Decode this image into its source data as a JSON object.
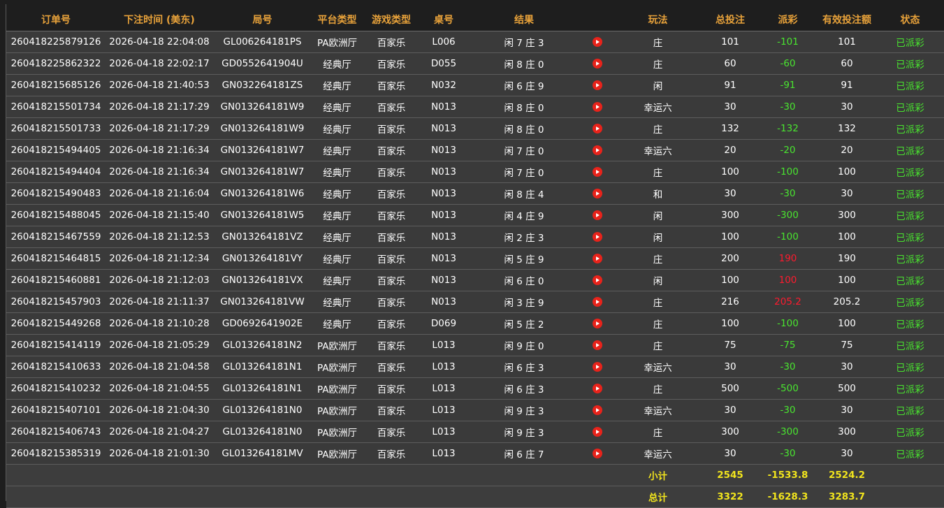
{
  "table": {
    "headers": {
      "order_id": "订单号",
      "bet_time": "下注时间 (美东)",
      "round_id": "局号",
      "platform": "平台类型",
      "game_type": "游戏类型",
      "table_no": "桌号",
      "result": "结果",
      "video": "",
      "play_type": "玩法",
      "total_bet": "总投注",
      "payout": "派彩",
      "valid_bet": "有效投注额",
      "status": "状态"
    },
    "rows": [
      {
        "order_id": "260418225879126",
        "bet_time": "2026-04-18 22:04:08",
        "round_id": "GL006264181PS",
        "platform": "PA欧洲厅",
        "game_type": "百家乐",
        "table_no": "L006",
        "result": "闲 7 庄 3",
        "play_type": "庄",
        "total_bet": "101",
        "payout": "-101",
        "valid_bet": "101",
        "status": "已派彩"
      },
      {
        "order_id": "260418225862322",
        "bet_time": "2026-04-18 22:02:17",
        "round_id": "GD0552641904U",
        "platform": "经典厅",
        "game_type": "百家乐",
        "table_no": "D055",
        "result": "闲 8 庄 0",
        "play_type": "庄",
        "total_bet": "60",
        "payout": "-60",
        "valid_bet": "60",
        "status": "已派彩"
      },
      {
        "order_id": "260418215685126",
        "bet_time": "2026-04-18 21:40:53",
        "round_id": "GN032264181ZS",
        "platform": "经典厅",
        "game_type": "百家乐",
        "table_no": "N032",
        "result": "闲 6 庄 9",
        "play_type": "闲",
        "total_bet": "91",
        "payout": "-91",
        "valid_bet": "91",
        "status": "已派彩"
      },
      {
        "order_id": "260418215501734",
        "bet_time": "2026-04-18 21:17:29",
        "round_id": "GN013264181W9",
        "platform": "经典厅",
        "game_type": "百家乐",
        "table_no": "N013",
        "result": "闲 8 庄 0",
        "play_type": "幸运六",
        "total_bet": "30",
        "payout": "-30",
        "valid_bet": "30",
        "status": "已派彩"
      },
      {
        "order_id": "260418215501733",
        "bet_time": "2026-04-18 21:17:29",
        "round_id": "GN013264181W9",
        "platform": "经典厅",
        "game_type": "百家乐",
        "table_no": "N013",
        "result": "闲 8 庄 0",
        "play_type": "庄",
        "total_bet": "132",
        "payout": "-132",
        "valid_bet": "132",
        "status": "已派彩"
      },
      {
        "order_id": "260418215494405",
        "bet_time": "2026-04-18 21:16:34",
        "round_id": "GN013264181W7",
        "platform": "经典厅",
        "game_type": "百家乐",
        "table_no": "N013",
        "result": "闲 7 庄 0",
        "play_type": "幸运六",
        "total_bet": "20",
        "payout": "-20",
        "valid_bet": "20",
        "status": "已派彩"
      },
      {
        "order_id": "260418215494404",
        "bet_time": "2026-04-18 21:16:34",
        "round_id": "GN013264181W7",
        "platform": "经典厅",
        "game_type": "百家乐",
        "table_no": "N013",
        "result": "闲 7 庄 0",
        "play_type": "庄",
        "total_bet": "100",
        "payout": "-100",
        "valid_bet": "100",
        "status": "已派彩"
      },
      {
        "order_id": "260418215490483",
        "bet_time": "2026-04-18 21:16:04",
        "round_id": "GN013264181W6",
        "platform": "经典厅",
        "game_type": "百家乐",
        "table_no": "N013",
        "result": "闲 8 庄 4",
        "play_type": "和",
        "total_bet": "30",
        "payout": "-30",
        "valid_bet": "30",
        "status": "已派彩"
      },
      {
        "order_id": "260418215488045",
        "bet_time": "2026-04-18 21:15:40",
        "round_id": "GN013264181W5",
        "platform": "经典厅",
        "game_type": "百家乐",
        "table_no": "N013",
        "result": "闲 4 庄 9",
        "play_type": "闲",
        "total_bet": "300",
        "payout": "-300",
        "valid_bet": "300",
        "status": "已派彩"
      },
      {
        "order_id": "260418215467559",
        "bet_time": "2026-04-18 21:12:53",
        "round_id": "GN013264181VZ",
        "platform": "经典厅",
        "game_type": "百家乐",
        "table_no": "N013",
        "result": "闲 2 庄 3",
        "play_type": "闲",
        "total_bet": "100",
        "payout": "-100",
        "valid_bet": "100",
        "status": "已派彩"
      },
      {
        "order_id": "260418215464815",
        "bet_time": "2026-04-18 21:12:34",
        "round_id": "GN013264181VY",
        "platform": "经典厅",
        "game_type": "百家乐",
        "table_no": "N013",
        "result": "闲 5 庄 9",
        "play_type": "庄",
        "total_bet": "200",
        "payout": "190",
        "valid_bet": "190",
        "status": "已派彩"
      },
      {
        "order_id": "260418215460881",
        "bet_time": "2026-04-18 21:12:03",
        "round_id": "GN013264181VX",
        "platform": "经典厅",
        "game_type": "百家乐",
        "table_no": "N013",
        "result": "闲 6 庄 0",
        "play_type": "闲",
        "total_bet": "100",
        "payout": "100",
        "valid_bet": "100",
        "status": "已派彩"
      },
      {
        "order_id": "260418215457903",
        "bet_time": "2026-04-18 21:11:37",
        "round_id": "GN013264181VW",
        "platform": "经典厅",
        "game_type": "百家乐",
        "table_no": "N013",
        "result": "闲 3 庄 9",
        "play_type": "庄",
        "total_bet": "216",
        "payout": "205.2",
        "valid_bet": "205.2",
        "status": "已派彩"
      },
      {
        "order_id": "260418215449268",
        "bet_time": "2026-04-18 21:10:28",
        "round_id": "GD0692641902E",
        "platform": "经典厅",
        "game_type": "百家乐",
        "table_no": "D069",
        "result": "闲 5 庄 2",
        "play_type": "庄",
        "total_bet": "100",
        "payout": "-100",
        "valid_bet": "100",
        "status": "已派彩"
      },
      {
        "order_id": "260418215414119",
        "bet_time": "2026-04-18 21:05:29",
        "round_id": "GL013264181N2",
        "platform": "PA欧洲厅",
        "game_type": "百家乐",
        "table_no": "L013",
        "result": "闲 9 庄 0",
        "play_type": "庄",
        "total_bet": "75",
        "payout": "-75",
        "valid_bet": "75",
        "status": "已派彩"
      },
      {
        "order_id": "260418215410633",
        "bet_time": "2026-04-18 21:04:58",
        "round_id": "GL013264181N1",
        "platform": "PA欧洲厅",
        "game_type": "百家乐",
        "table_no": "L013",
        "result": "闲 6 庄 3",
        "play_type": "幸运六",
        "total_bet": "30",
        "payout": "-30",
        "valid_bet": "30",
        "status": "已派彩"
      },
      {
        "order_id": "260418215410232",
        "bet_time": "2026-04-18 21:04:55",
        "round_id": "GL013264181N1",
        "platform": "PA欧洲厅",
        "game_type": "百家乐",
        "table_no": "L013",
        "result": "闲 6 庄 3",
        "play_type": "庄",
        "total_bet": "500",
        "payout": "-500",
        "valid_bet": "500",
        "status": "已派彩"
      },
      {
        "order_id": "260418215407101",
        "bet_time": "2026-04-18 21:04:30",
        "round_id": "GL013264181N0",
        "platform": "PA欧洲厅",
        "game_type": "百家乐",
        "table_no": "L013",
        "result": "闲 9 庄 3",
        "play_type": "幸运六",
        "total_bet": "30",
        "payout": "-30",
        "valid_bet": "30",
        "status": "已派彩"
      },
      {
        "order_id": "260418215406743",
        "bet_time": "2026-04-18 21:04:27",
        "round_id": "GL013264181N0",
        "platform": "PA欧洲厅",
        "game_type": "百家乐",
        "table_no": "L013",
        "result": "闲 9 庄 3",
        "play_type": "庄",
        "total_bet": "300",
        "payout": "-300",
        "valid_bet": "300",
        "status": "已派彩"
      },
      {
        "order_id": "260418215385319",
        "bet_time": "2026-04-18 21:01:30",
        "round_id": "GL013264181MV",
        "platform": "PA欧洲厅",
        "game_type": "百家乐",
        "table_no": "L013",
        "result": "闲 6 庄 7",
        "play_type": "幸运六",
        "total_bet": "30",
        "payout": "-30",
        "valid_bet": "30",
        "status": "已派彩"
      }
    ],
    "subtotal": {
      "label": "小计",
      "total_bet": "2545",
      "payout": "-1533.8",
      "valid_bet": "2524.2"
    },
    "total": {
      "label": "总计",
      "total_bet": "3322",
      "payout": "-1628.3",
      "valid_bet": "3283.7"
    }
  },
  "icons": {
    "video": "play-video-icon"
  },
  "colors": {
    "header_text": "#e8a23a",
    "row_bg": "#3a3a3a",
    "page_bg": "#1e1e1e",
    "payout_negative": "#49e52f",
    "payout_positive": "#ff1a2e",
    "status_text": "#49e52f",
    "summary_text": "#f2e51d",
    "play_icon": "#e8231b"
  }
}
